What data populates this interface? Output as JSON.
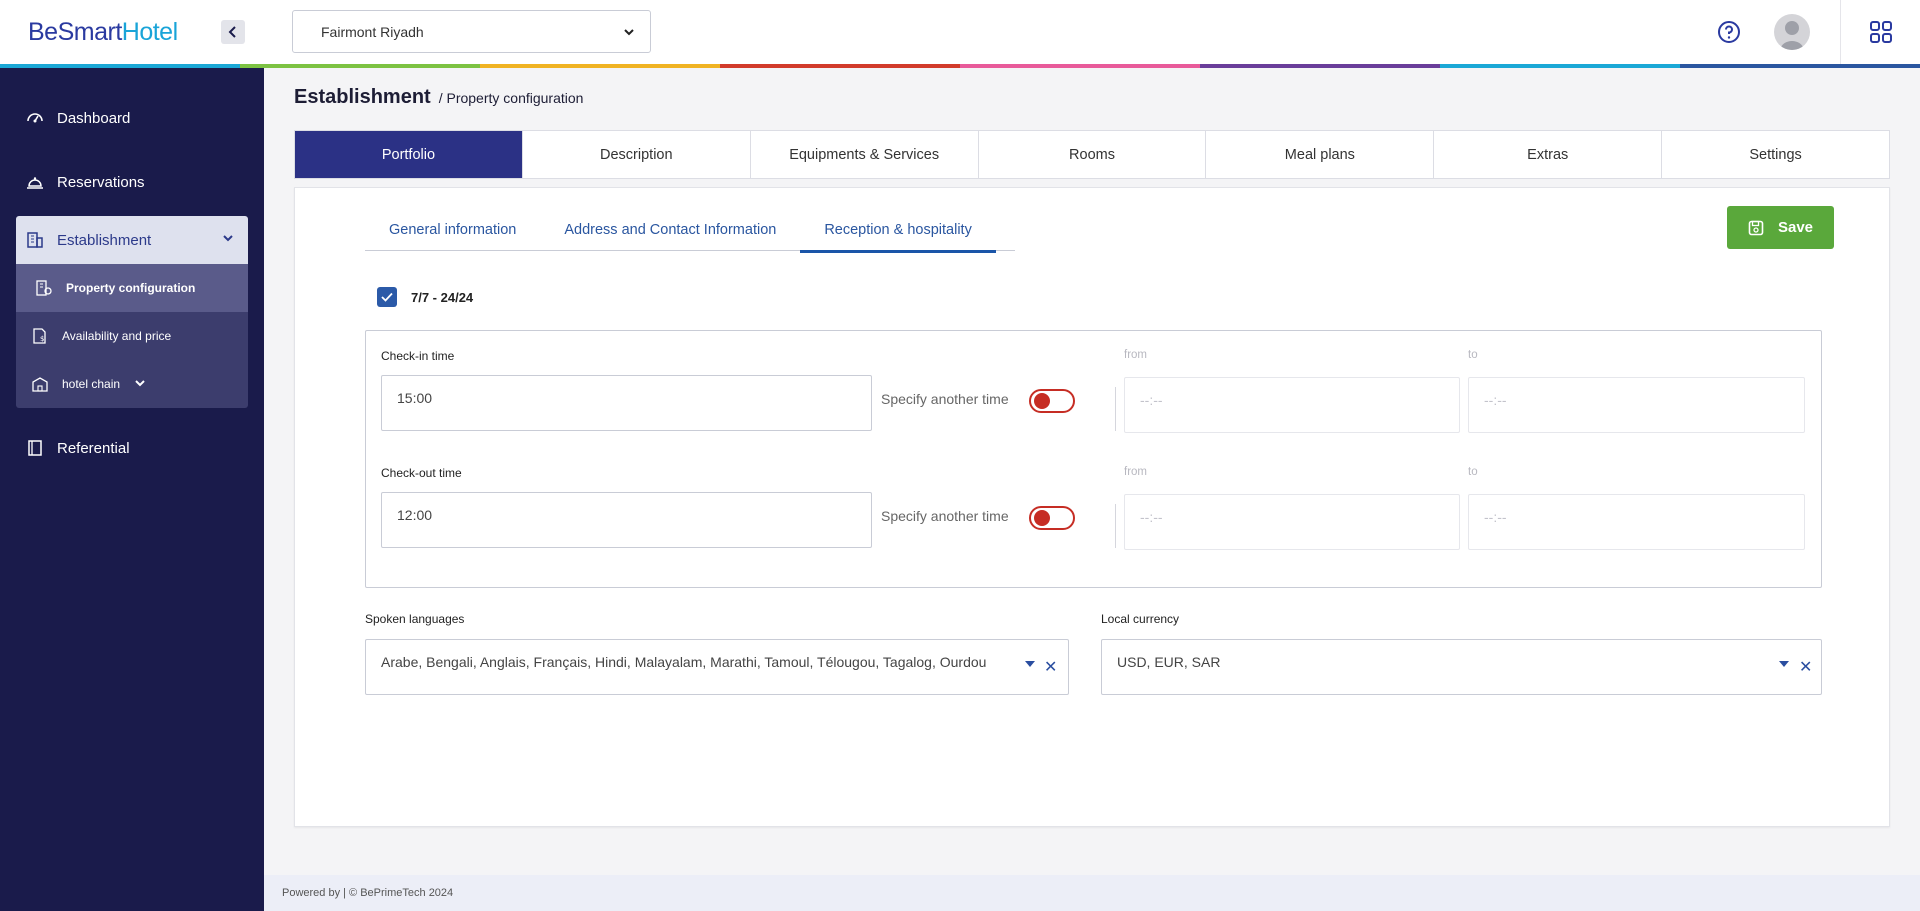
{
  "brand": {
    "be": "Be",
    "smart": "Smart",
    "hotel": "Hotel"
  },
  "colors": {
    "sidebar": "#1a1b4b",
    "accent": "#2b3185",
    "save": "#5aa83b",
    "toggle_off": "#c62d24",
    "link": "#2a56a0"
  },
  "rainbow": [
    "#1aa8d6",
    "#7cc242",
    "#f0b323",
    "#d23b2b",
    "#e85a9a",
    "#6a3d9a",
    "#1aa8d6",
    "#2a56a0"
  ],
  "sidebar": {
    "items": [
      {
        "label": "Dashboard",
        "icon": "gauge-icon"
      },
      {
        "label": "Reservations",
        "icon": "bell-icon"
      }
    ],
    "group": {
      "label": "Establishment",
      "icon": "building-icon",
      "sub": [
        {
          "label": "Property configuration",
          "icon": "building-settings-icon"
        },
        {
          "label": "Availability and price",
          "icon": "price-document-icon"
        },
        {
          "label": "hotel chain",
          "icon": "hotel-icon"
        }
      ]
    },
    "after": [
      {
        "label": "Referential",
        "icon": "book-icon"
      }
    ]
  },
  "topbar": {
    "hotel": "Fairmont Riyadh"
  },
  "breadcrumb": {
    "section": "Establishment",
    "page": "/ Property configuration"
  },
  "tabs": [
    "Portfolio",
    "Description",
    "Equipments & Services",
    "Rooms",
    "Meal plans",
    "Extras",
    "Settings"
  ],
  "subtabs": [
    "General information",
    "Address and Contact Information",
    "Reception & hospitality"
  ],
  "save_label": "Save",
  "open_24_7": {
    "label": "7/7 - 24/24",
    "checked": true
  },
  "checkin": {
    "label": "Check-in time",
    "value": "15:00",
    "specify_label": "Specify another time",
    "from_label": "from",
    "to_label": "to",
    "from_placeholder": "--:--",
    "to_placeholder": "--:--"
  },
  "checkout": {
    "label": "Check-out time",
    "value": "12:00",
    "specify_label": "Specify another time",
    "from_label": "from",
    "to_label": "to",
    "from_placeholder": "--:--",
    "to_placeholder": "--:--"
  },
  "languages": {
    "label": "Spoken languages",
    "value": "Arabe, Bengali, Anglais, Français, Hindi, Malayalam, Marathi, Tamoul, Télougou, Tagalog, Ourdou"
  },
  "currency": {
    "label": "Local currency",
    "value": "USD, EUR, SAR"
  },
  "footer": "Powered by | © BePrimeTech 2024"
}
